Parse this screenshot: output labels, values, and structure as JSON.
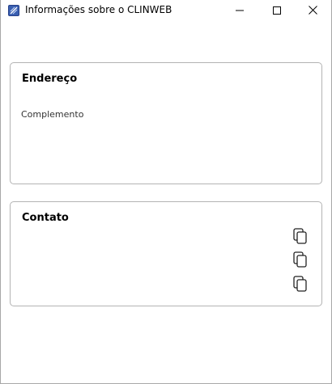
{
  "window": {
    "title": "Informações sobre o CLINWEB",
    "icon": "clinweb-app-icon",
    "buttons": [
      "minimize-icon",
      "maximize-icon",
      "close-icon"
    ]
  },
  "address_card": {
    "title": "Endereço",
    "complement_label": "Complemento"
  },
  "contact_card": {
    "title": "Contato",
    "copy_icons": [
      "copy-icon",
      "copy-icon",
      "copy-icon"
    ]
  },
  "colors": {
    "card_border": "#b3b3b3",
    "app_icon_blue": "#3a5fb0"
  }
}
